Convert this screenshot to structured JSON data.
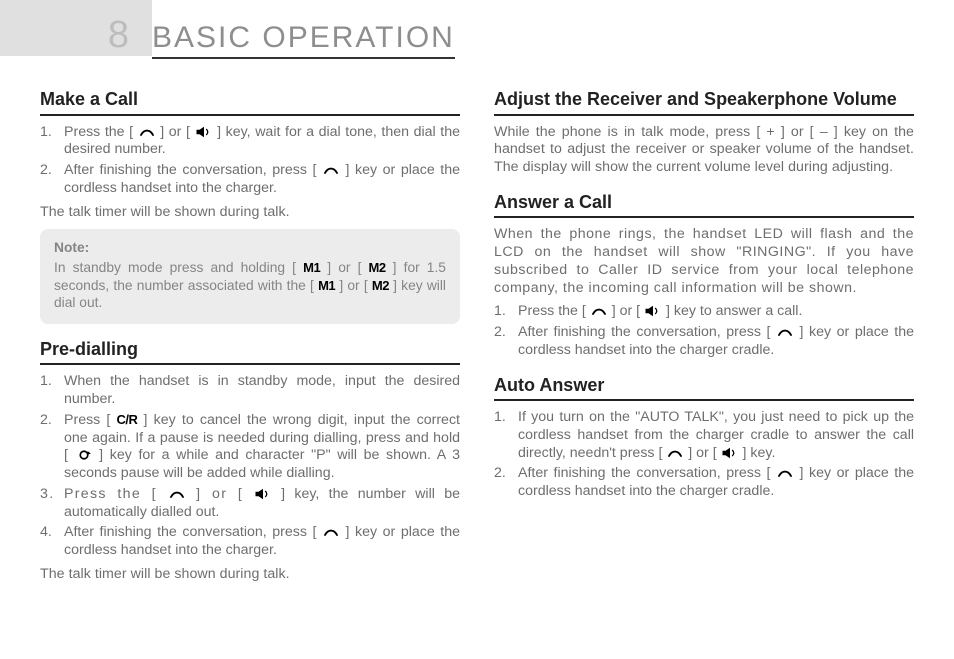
{
  "page_number": "8",
  "chapter_title": "BASIC OPERATION",
  "icons": {
    "talk": "talk-key-icon",
    "speaker": "speaker-key-icon",
    "m1": "M1",
    "m2": "M2",
    "cr": "C/R",
    "redial": "redial-key-icon"
  },
  "sections": {
    "make_call": {
      "title": "Make a Call",
      "step1_a": "Press the [ ",
      "step1_b": " ] or [ ",
      "step1_c": " ] key, wait for a dial tone, then dial the desired number.",
      "step2_a": "After finishing the conversation, press [ ",
      "step2_b": " ] key or place the cordless handset into the charger.",
      "after": "The talk timer will be shown during talk.",
      "note_label": "Note:",
      "note_a": "In standby mode press and holding [ ",
      "note_b": " ] or [ ",
      "note_c": " ] for 1.5 seconds, the number associated with the [ ",
      "note_d": " ] or [ ",
      "note_e": " ] key will dial out."
    },
    "pre_dial": {
      "title": "Pre-dialling",
      "step1": "When the handset is in standby mode, input the desired number.",
      "step2_a": "Press [ ",
      "step2_b": " ] key to cancel the wrong digit, input the correct one again. If a pause is needed during dialling, press and hold [ ",
      "step2_c": " ] key for a while and character \"P\" will be shown. A 3 seconds pause will be added while dialling.",
      "step3_a": "Press the [ ",
      "step3_b": " ] or [ ",
      "step3_c": " ] key, the number will be automatically dialled out.",
      "step4_a": "After finishing the conversation, press [ ",
      "step4_b": " ] key or place the cordless handset into the charger.",
      "after": "The talk timer will be shown during talk."
    },
    "adjust_vol": {
      "title": "Adjust the Receiver and Speakerphone Volume",
      "body": "While the phone is in talk mode, press [ + ] or [ – ] key on the handset to adjust the receiver or speaker volume of the handset. The display will show the current volume level during adjusting."
    },
    "answer": {
      "title": "Answer a Call",
      "intro": "When the phone rings, the handset LED will flash and the LCD on the handset will show \"RINGING\". If you have subscribed to Caller ID service from your local telephone company, the incoming call information will be shown.",
      "step1_a": "Press the [ ",
      "step1_b": " ] or [ ",
      "step1_c": " ] key to answer a call.",
      "step2_a": "After finishing the conversation, press [ ",
      "step2_b": " ] key or place the cordless handset into the charger cradle."
    },
    "auto": {
      "title": "Auto Answer",
      "step1_a": "If you turn on the \"AUTO TALK\", you just need to pick up the cordless handset from the charger cradle to answer the call directly, needn't press [ ",
      "step1_b": " ] or [ ",
      "step1_c": " ] key.",
      "step2_a": "After finishing the conversation, press [ ",
      "step2_b": " ] key or place the cordless handset into the charger cradle."
    }
  }
}
